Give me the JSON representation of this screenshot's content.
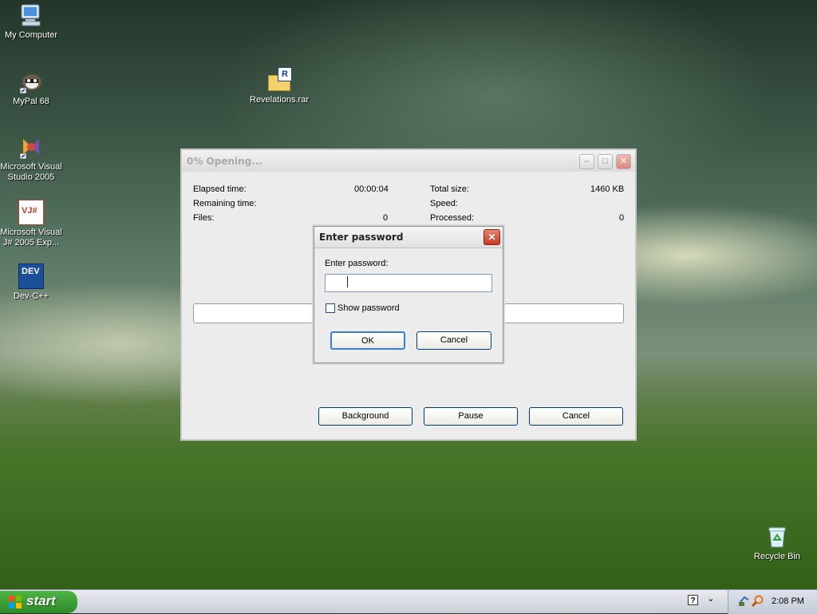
{
  "desktop": {
    "icons": [
      {
        "label": "My Computer",
        "icon": "computer-icon"
      },
      {
        "label": "MyPal 68",
        "icon": "raccoon-browser-icon"
      },
      {
        "label": "Microsoft Visual Studio 2005",
        "icon": "visual-studio-icon"
      },
      {
        "label": "Microsoft Visual J# 2005 Exp...",
        "icon": "vj-sharp-icon"
      },
      {
        "label": "Dev-C++",
        "icon": "dev-cpp-icon"
      },
      {
        "label": "Revelations.rar",
        "icon": "rar-archive-icon"
      },
      {
        "label": "Recycle Bin",
        "icon": "recycle-bin-icon"
      }
    ],
    "rar_glyph": "R",
    "vj_glyph": "VJ#",
    "dev_glyph": "DEV"
  },
  "progress_window": {
    "title": "0% Opening...",
    "caption_buttons": {
      "minimize": "–",
      "maximize": "□",
      "close": "✕"
    },
    "stats": {
      "elapsed_label": "Elapsed time:",
      "elapsed_value": "00:00:04",
      "remaining_label": "Remaining time:",
      "remaining_value": "",
      "files_label": "Files:",
      "files_value": "0",
      "total_size_label": "Total size:",
      "total_size_value": "1460 KB",
      "speed_label": "Speed:",
      "speed_value": "",
      "processed_label": "Processed:",
      "processed_value": "0"
    },
    "progress": 0,
    "buttons": {
      "background": "Background",
      "pause": "Pause",
      "cancel": "Cancel"
    }
  },
  "password_dialog": {
    "title": "Enter password",
    "close": "✕",
    "prompt_label": "Enter password:",
    "password_value": "",
    "show_password_label": "Show password",
    "show_password_checked": false,
    "ok_label": "OK",
    "cancel_label": "Cancel"
  },
  "taskbar": {
    "start_label": "start",
    "clock": "2:08 PM",
    "help_glyph": "?",
    "expand_glyph": "⌄"
  },
  "colors": {
    "xp_blue_border": "#003c74",
    "start_green": "#2e8b29",
    "close_red": "#d9452b"
  }
}
